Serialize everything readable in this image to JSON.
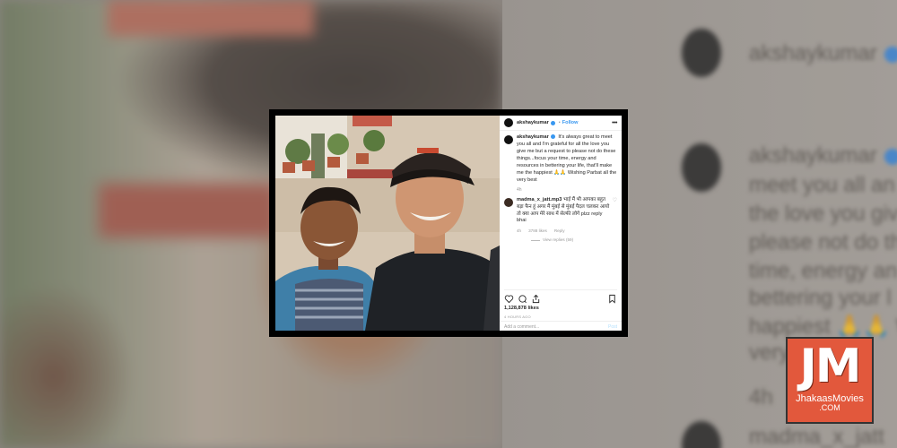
{
  "post": {
    "username": "akshaykumar",
    "follow_label": "Follow",
    "more_label": "•••",
    "caption": "It's always great to meet you all and I'm grateful for all the love you give me but a request to please not do these things...focus your time, energy and resources in bettering your life, that'll make me the happiest 🙏🙏 Wishing Parbat all the very best",
    "caption_time": "4h",
    "reply": {
      "username": "madma_x_jatt.mp3",
      "text": "भाई मैं भी आपका बहुत बड़ा फैन हूं अगर मैं मुंबई से मुंबई पैदल चलकर आयो तो क्या आप मेरे साथ में सेल्फी लोगे plzz reply bhai",
      "time": "4h",
      "likes": "3788 likes",
      "reply_label": "Reply",
      "view_replies": "View replies (59)"
    },
    "likes": "1,128,878 likes",
    "posted_ago": "4 HOURS AGO",
    "add_comment_placeholder": "Add a comment...",
    "post_label": "Post"
  },
  "background": {
    "ghost_lines": [
      "akshaykumar",
      "akshaykumar",
      "meet you all an",
      "the love you giv",
      "please not do th",
      "time, energy an",
      "bettering your l",
      "happiest 🙏🙏 W",
      "very best",
      "4h",
      "madma_x_jatt"
    ]
  },
  "watermark": {
    "logo_text": "JM",
    "site_name": "JhakaasMovies",
    "site_domain": ".COM"
  },
  "colors": {
    "accent_blue": "#3897f0",
    "logo_orange": "#e2583c"
  }
}
